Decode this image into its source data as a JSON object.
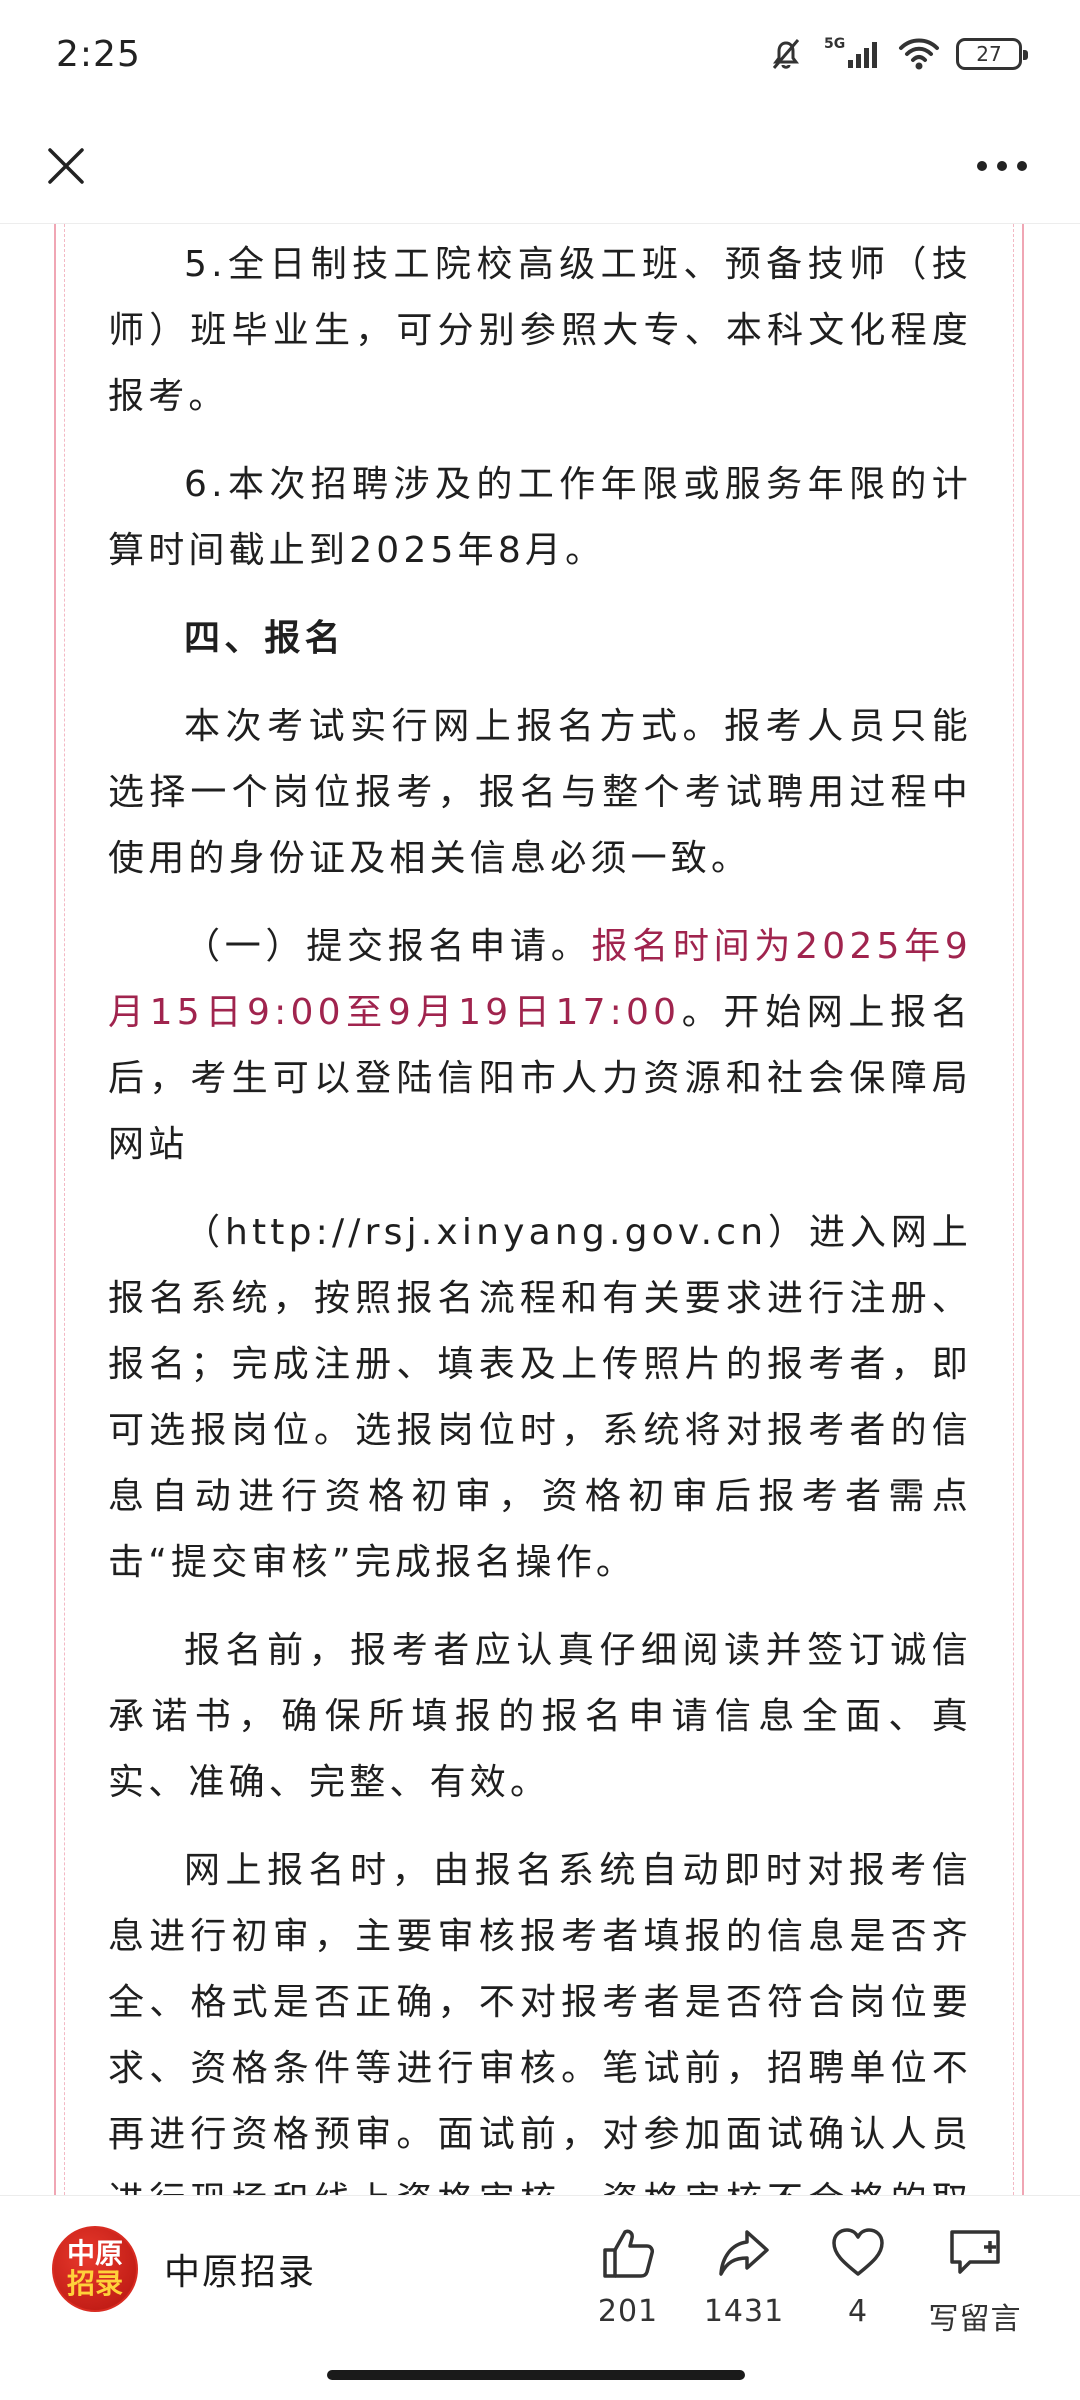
{
  "status_bar": {
    "time": "2:25",
    "network": "5G",
    "battery": "27"
  },
  "article": {
    "paragraphs": [
      "5.全日制技工院校高级工班、预备技师（技师）班毕业生，可分别参照大专、本科文化程度报考。",
      "6.本次招聘涉及的工作年限或服务年限的计算时间截止到2025年8月。"
    ],
    "heading": "四、报名",
    "p3": "本次考试实行网上报名方式。报考人员只能选择一个岗位报考，报名与整个考试聘用过程中使用的身份证及相关信息必须一致。",
    "p4_a": "（一）提交报名申请。",
    "p4_b": "报名时间为2025年9月15日9:00至9月19日17:00",
    "p4_c": "。开始网上报名后，考生可以登陆信阳市人力资源和社会保障局网站",
    "p5": "（http://rsj.xinyang.gov.cn）进入网上报名系统，按照报名流程和有关要求进行注册、报名；完成注册、填表及上传照片的报考者，即可选报岗位。选报岗位时，系统将对报考者的信息自动进行资格初审，资格初审后报考者需点击“提交审核”完成报名操作。",
    "p6": "报名前，报考者应认真仔细阅读并签订诚信承诺书，确保所填报的报名申请信息全面、真实、准确、完整、有效。",
    "p7": "网上报名时，由报名系统自动即时对报考信息进行初审，主要审核报考者填报的信息是否齐全、格式是否正确，不对报考者是否符合岗位要求、资格条件等进行审核。笔试前，招聘单位不再进行资格预审。面试前，对参加面试确认人员进行现场和线上资格审核，资格审核不合格的取消面试资格。"
  },
  "bottom_bar": {
    "account_name": "中原招录",
    "logo_line1": "中原",
    "logo_line2": "招录",
    "like_count": "201",
    "share_count": "1431",
    "favorite_count": "4",
    "comment_label": "写留言"
  },
  "colors": {
    "accent": "#a0244e",
    "frame": "#f0a6b4",
    "logo": "#d92c22"
  }
}
